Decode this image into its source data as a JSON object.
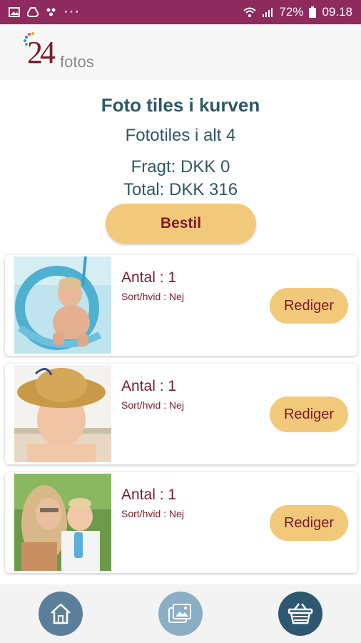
{
  "status_bar": {
    "dots": "···",
    "battery": "72%",
    "time": "09.18",
    "icons": [
      "image-icon",
      "drive-icon",
      "dots-icon",
      "wifi-icon",
      "signal-icon",
      "battery-icon"
    ]
  },
  "header": {
    "logo_number": "24",
    "logo_text": "fotos"
  },
  "summary": {
    "title": "Foto tiles i kurven",
    "count": "Fototiles i alt 4",
    "freight": "Fragt: DKK 0",
    "total": "Total: DKK 316",
    "order_label": "Bestil"
  },
  "items": [
    {
      "qty": "Antal : 1",
      "bw": "Sort/hvid : Nej",
      "edit_label": "Rediger"
    },
    {
      "qty": "Antal : 1",
      "bw": "Sort/hvid : Nej",
      "edit_label": "Rediger"
    },
    {
      "qty": "Antal : 1",
      "bw": "Sort/hvid : Nej",
      "edit_label": "Rediger"
    }
  ],
  "bottom_nav": {
    "icons": [
      "home-icon",
      "photos-icon",
      "basket-icon"
    ]
  },
  "colors": {
    "status_bar": "#8e2a5e",
    "accent": "#f2c97a",
    "text_dark_red": "#7a1d2a",
    "text_teal": "#2e5866"
  }
}
